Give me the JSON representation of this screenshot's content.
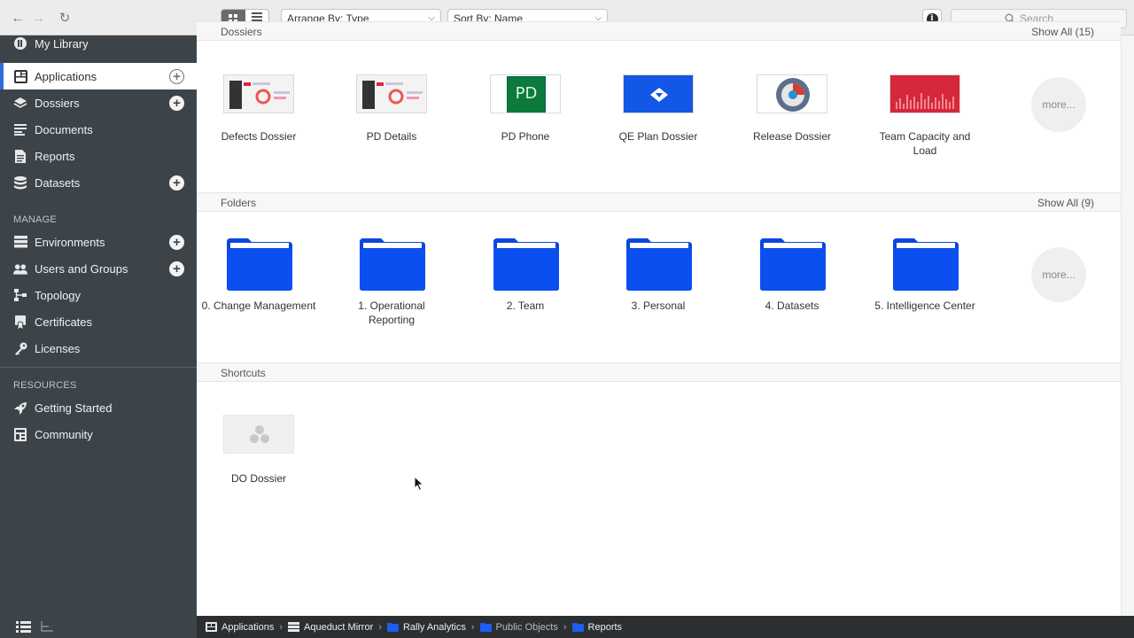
{
  "toolbar": {
    "back": "←",
    "forward": "→",
    "refresh": "↻",
    "arrange_by": "Arrange By: Type",
    "sort_by": "Sort By: Name",
    "info": "i",
    "search_placeholder": "Search"
  },
  "sidebar": {
    "top_item": "My Library",
    "items": [
      {
        "label": "Applications",
        "icon": "applications-icon",
        "has_add": true,
        "active": true
      },
      {
        "label": "Dossiers",
        "icon": "dossiers-icon",
        "has_add": true
      },
      {
        "label": "Documents",
        "icon": "documents-icon",
        "has_add": false
      },
      {
        "label": "Reports",
        "icon": "reports-icon",
        "has_add": false
      },
      {
        "label": "Datasets",
        "icon": "datasets-icon",
        "has_add": true
      }
    ],
    "manage_heading": "MANAGE",
    "manage_items": [
      {
        "label": "Environments",
        "icon": "environments-icon",
        "has_add": true
      },
      {
        "label": "Users and Groups",
        "icon": "users-icon",
        "has_add": true
      },
      {
        "label": "Topology",
        "icon": "topology-icon",
        "has_add": false
      },
      {
        "label": "Certificates",
        "icon": "certificates-icon",
        "has_add": false
      },
      {
        "label": "Licenses",
        "icon": "licenses-icon",
        "has_add": false
      }
    ],
    "resources_heading": "RESOURCES",
    "resources_items": [
      {
        "label": "Getting Started",
        "icon": "rocket-icon"
      },
      {
        "label": "Community",
        "icon": "community-icon"
      }
    ],
    "add_symbol": "+"
  },
  "dossiers": {
    "partial_title": "Dossiers",
    "partial_show_all": "Show All (15)",
    "items": [
      {
        "label": "Defects Dossier",
        "thumb": "dashboard-thumb"
      },
      {
        "label": "PD Details",
        "thumb": "dashboard-thumb"
      },
      {
        "label": "PD Phone",
        "thumb": "pd-thumb",
        "thumb_text": "PD"
      },
      {
        "label": "QE Plan Dossier",
        "thumb": "blue-thumb"
      },
      {
        "label": "Release Dossier",
        "thumb": "gauge-thumb"
      },
      {
        "label": "Team Capacity and Load",
        "thumb": "red-chart-thumb"
      }
    ],
    "more": "more..."
  },
  "folders": {
    "title": "Folders",
    "show_all": "Show All (9)",
    "items": [
      "0. Change Management",
      "1. Operational Reporting",
      "2. Team",
      "3. Personal",
      "4. Datasets",
      "5. Intelligence Center"
    ],
    "more": "more..."
  },
  "shortcuts": {
    "title": "Shortcuts",
    "items": [
      {
        "label": "DO Dossier"
      }
    ]
  },
  "breadcrumb": [
    {
      "label": "Applications",
      "icon": "applications-icon"
    },
    {
      "label": "Aqueduct Mirror",
      "icon": "server-icon"
    },
    {
      "label": "Rally Analytics",
      "icon": "project-icon"
    },
    {
      "label": "Public Objects",
      "icon": "folder-icon",
      "dim": true
    },
    {
      "label": "Reports",
      "icon": "folder-icon"
    }
  ],
  "colors": {
    "sidebar_bg": "#3c4449",
    "accent": "#2f6fd6",
    "folder_blue": "#0a47e0"
  }
}
